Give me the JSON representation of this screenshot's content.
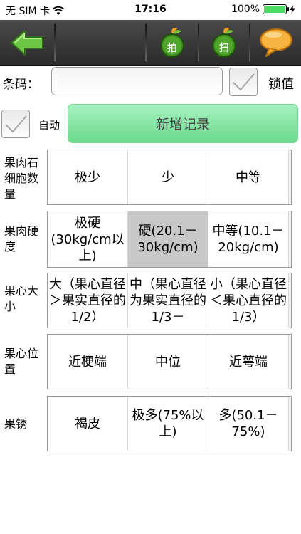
{
  "status_bar": {
    "carrier": "无 SIM 卡",
    "time": "17:16",
    "battery_percent": "100%",
    "battery_level": 1.0
  },
  "toolbar": {
    "back_icon": "left-arrow-icon",
    "photo_label": "拍",
    "scan_label": "扫",
    "chat_icon": "speech-bubble-icon"
  },
  "barcode": {
    "label": "条码：",
    "value": "",
    "lock_label": "锁值",
    "lock_checked": false
  },
  "auto": {
    "label": "自动",
    "checked": false
  },
  "add_record_label": "新增记录",
  "traits": [
    {
      "label": "果肉石细胞数量",
      "options": [
        "极少",
        "少",
        "中等"
      ],
      "selected": -1
    },
    {
      "label": "果肉硬度",
      "options": [
        "极硬(30kg/cm以上)",
        "硬(20.1－30kg/cm)",
        "中等(10.1－20kg/cm)"
      ],
      "selected": 1
    },
    {
      "label": "果心大小",
      "options": [
        "大（果心直径＞果实直径的1/2）",
        "中（果心直径为果实直径的1/3－",
        "小（果心直径＜果心直径的1/3）"
      ],
      "selected": -1
    },
    {
      "label": "果心位置",
      "options": [
        "近梗端",
        "中位",
        "近萼端"
      ],
      "selected": -1
    },
    {
      "label": "果锈",
      "options": [
        "褐皮",
        "极多(75%以上)",
        "多(50.1－75%)"
      ],
      "selected": -1
    }
  ],
  "colors": {
    "add_button": "#8ee6a8",
    "selected_option": "#c8c8c8",
    "toolbar": "#3a3a3a",
    "back_arrow": "#6cc644",
    "chat_bubble": "#f5a623"
  }
}
